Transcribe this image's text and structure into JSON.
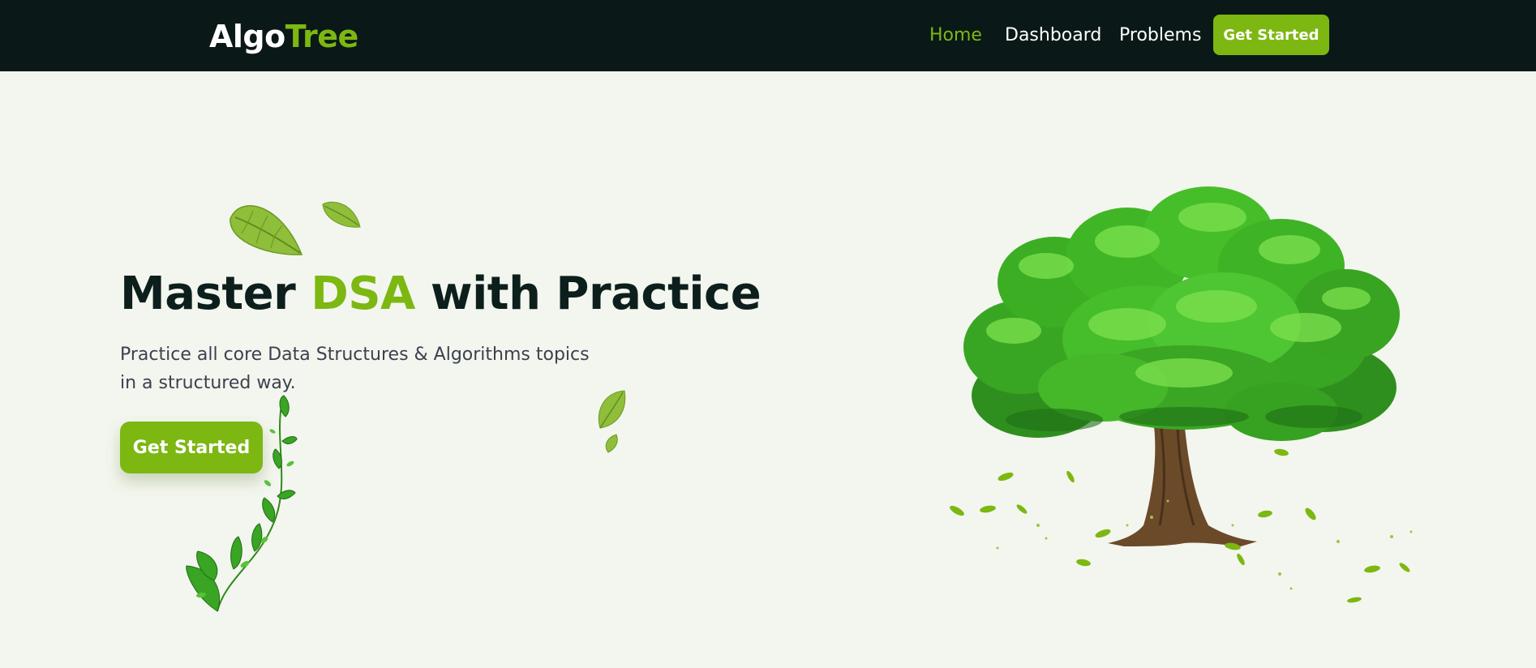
{
  "brand": {
    "part1": "Algo",
    "part2": "Tree"
  },
  "nav": {
    "links": [
      {
        "label": "Home",
        "active": true
      },
      {
        "label": "Dashboard",
        "active": false
      },
      {
        "label": "Problems",
        "active": false
      }
    ],
    "cta_label": "Get Started"
  },
  "hero": {
    "title_part1": "Master ",
    "title_accent": "DSA",
    "title_part2": " with Practice",
    "subtitle": "Practice all core Data Structures & Algorithms topics in a structured way.",
    "cta_label": "Get Started"
  },
  "colors": {
    "accent": "#7db712",
    "navbar_bg": "#0a1917",
    "page_bg": "#f3f6ee",
    "title": "#0d1f1c"
  },
  "icons": [
    "leaf-icon",
    "tree-illustration",
    "leaf-vine-icon"
  ]
}
